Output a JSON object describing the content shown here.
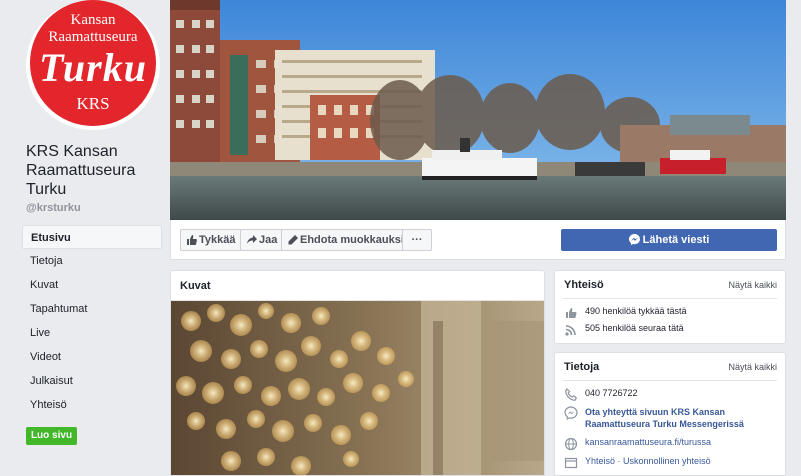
{
  "logo": {
    "line1": "Kansan",
    "line2": "Raamattuseura",
    "line3": "Turku",
    "line4": "KRS",
    "color": "#e3262b"
  },
  "page": {
    "name": "KRS Kansan Raamattuseura Turku",
    "handle": "@krsturku"
  },
  "nav": {
    "items": [
      {
        "label": "Etusivu",
        "active": true
      },
      {
        "label": "Tietoja"
      },
      {
        "label": "Kuvat"
      },
      {
        "label": "Tapahtumat"
      },
      {
        "label": "Live"
      },
      {
        "label": "Videot"
      },
      {
        "label": "Julkaisut"
      },
      {
        "label": "Yhteisö"
      }
    ],
    "create_label": "Luo sivu"
  },
  "actions": {
    "like": "Tykkää",
    "share": "Jaa",
    "suggest": "Ehdota muokkauksia",
    "more": "···",
    "send": "Lähetä viesti"
  },
  "photos": {
    "title": "Kuvat"
  },
  "community": {
    "title": "Yhteisö",
    "see_all": "Näytä kaikki",
    "likes": "490 henkilöä tykkää tästä",
    "follows": "505 henkilöä seuraa tätä"
  },
  "info": {
    "title": "Tietoja",
    "see_all": "Näytä kaikki",
    "phone": "040 7726722",
    "messenger": "Ota yhteyttä sivuun KRS Kansan Raamattuseura Turku Messengerissä",
    "website": "kansanraamattuseura.fi/turussa",
    "category": "Yhteisö · Uskonnollinen yhteisö"
  },
  "colors": {
    "brand_blue": "#4267b2",
    "green": "#42b72a",
    "page_bg": "#e9ebee"
  }
}
